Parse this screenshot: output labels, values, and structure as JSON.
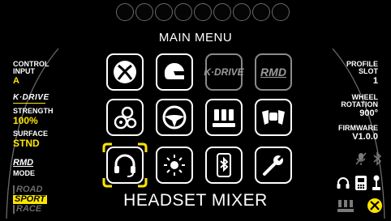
{
  "header": {
    "title": "MAIN MENU",
    "led_count": 9
  },
  "left_panel": {
    "control_input_label": "CONTROL INPUT",
    "control_input_value": "A",
    "kdrive_logo": "K·DRIVE",
    "strength_label": "STRENGTH",
    "strength_value": "100%",
    "surface_label": "SURFACE",
    "surface_value": "STND",
    "rmd_logo": "RMD",
    "mode_label": "MODE",
    "mode_options": [
      "ROAD",
      "SPORT",
      "RACE"
    ],
    "mode_selected": "SPORT"
  },
  "right_panel": {
    "profile_slot_label": "PROFILE SLOT",
    "profile_slot_value": "1",
    "wheel_rotation_label": "WHEEL ROTATION",
    "wheel_rotation_value": "900°",
    "firmware_label": "FIRMWARE",
    "firmware_value": "V1.0.0"
  },
  "menu": {
    "tiles": [
      {
        "name": "xbox",
        "icon": "xbox-icon"
      },
      {
        "name": "helmet",
        "icon": "helmet-icon"
      },
      {
        "name": "kdrive",
        "text": "K·DRIVE"
      },
      {
        "name": "rmd",
        "text": "RMD"
      },
      {
        "name": "gears",
        "icon": "gears-icon"
      },
      {
        "name": "steering-wheel",
        "icon": "steering-wheel-icon"
      },
      {
        "name": "pedals",
        "icon": "pedals-icon"
      },
      {
        "name": "paddles",
        "icon": "paddles-icon"
      },
      {
        "name": "headset",
        "icon": "headset-icon",
        "selected": true
      },
      {
        "name": "brightness",
        "icon": "brightness-icon"
      },
      {
        "name": "bluetooth",
        "icon": "bluetooth-icon"
      },
      {
        "name": "settings",
        "icon": "wrench-icon"
      }
    ],
    "selected_caption": "HEADSET MIXER"
  },
  "colors": {
    "accent": "#ffe500",
    "background": "#000000",
    "tile_border": "#ffffff",
    "dim": "#8a8a8a"
  }
}
